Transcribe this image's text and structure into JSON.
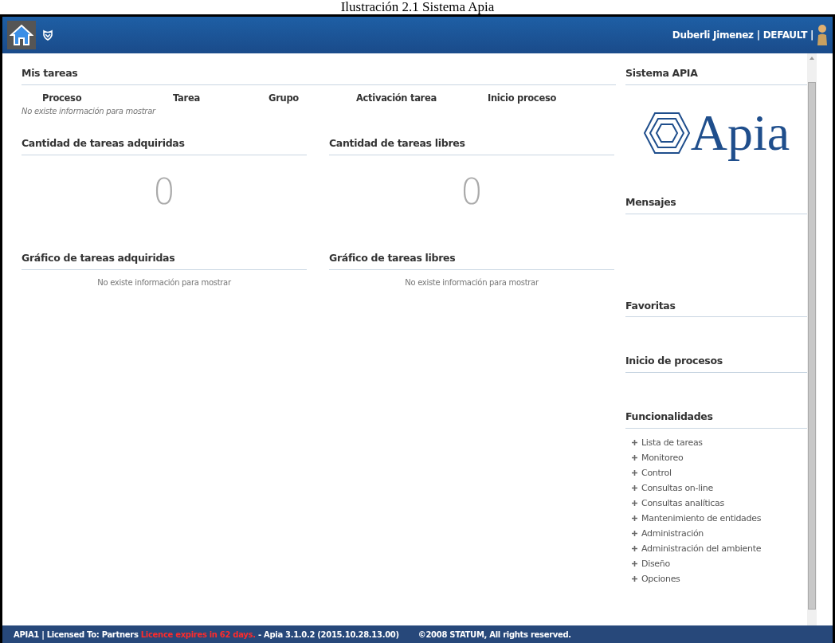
{
  "caption": "Ilustración 2.1 Sistema Apia",
  "header": {
    "user": "Duberli Jimenez | DEFAULT |"
  },
  "my_tasks": {
    "title": "Mis tareas",
    "columns": [
      "Proceso",
      "Tarea",
      "Grupo",
      "Activación tarea",
      "Inicio proceso"
    ],
    "empty": "No existe información para mostrar"
  },
  "counters": [
    {
      "title": "Cantidad de tareas adquiridas",
      "value": "0"
    },
    {
      "title": "Cantidad de tareas libres",
      "value": "0"
    }
  ],
  "charts": [
    {
      "title": "Gráfico de tareas adquiridas",
      "empty": "No existe información para mostrar"
    },
    {
      "title": "Gráfico de tareas libres",
      "empty": "No existe información para mostrar"
    }
  ],
  "sidebar": {
    "system_title": "Sistema APIA",
    "logo_text": "Apia",
    "sections": [
      "Mensajes",
      "Favoritas",
      "Inicio de procesos"
    ],
    "functions_title": "Funcionalidades",
    "functions": [
      "Lista de tareas",
      "Monitoreo",
      "Control",
      "Consultas on-line",
      "Consultas analíticas",
      "Mantenimiento de entidades",
      "Administración",
      "Administración del ambiente",
      "Diseño",
      "Opciones"
    ]
  },
  "footer": {
    "license": "APIA1 | Licensed To: Partners",
    "warning": "Licence expires in 62 days.",
    "version": "- Apia 3.1.0.2 (2015.10.28.13.00)",
    "copyright": "©2008 STATUM, All rights reserved."
  }
}
